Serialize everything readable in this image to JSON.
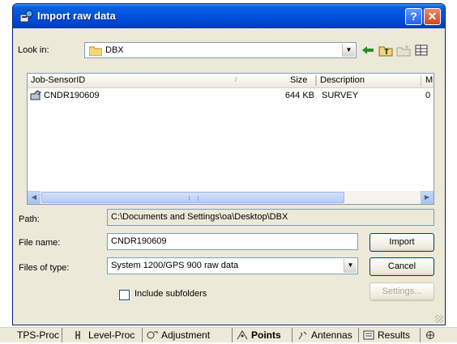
{
  "window": {
    "title": "Import raw data",
    "help_label": "?",
    "close_label": "✕"
  },
  "look_in": {
    "label": "Look in:",
    "value": "DBX",
    "icons": [
      "back-arrow-icon",
      "up-folder-icon",
      "new-folder-icon",
      "view-menu-icon"
    ]
  },
  "file_list": {
    "columns": [
      "Job-SensorID",
      "Size",
      "Description",
      "M"
    ],
    "rows": [
      {
        "name": "CNDR190609",
        "size": "644 KB",
        "description": "SURVEY",
        "m": "0"
      }
    ]
  },
  "path": {
    "label": "Path:",
    "value": "C:\\Documents and Settings\\oa\\Desktop\\DBX"
  },
  "file_name": {
    "label": "File name:",
    "value": "CNDR190609"
  },
  "file_type": {
    "label": "Files of type:",
    "value": "System 1200/GPS 900 raw data"
  },
  "include_subfolders": {
    "label": "Include subfolders",
    "checked": false
  },
  "buttons": {
    "import": "Import",
    "cancel": "Cancel",
    "settings": "Settings..."
  },
  "taskbar": {
    "tabs": [
      {
        "label": "TPS-Proc",
        "icon": "tps-icon",
        "active": false
      },
      {
        "label": "Level-Proc",
        "icon": "level-icon",
        "active": false
      },
      {
        "label": "Adjustment",
        "icon": "adjustment-icon",
        "active": false
      },
      {
        "label": "Points",
        "icon": "points-icon",
        "active": true
      },
      {
        "label": "Antennas",
        "icon": "antenna-icon",
        "active": false
      },
      {
        "label": "Results",
        "icon": "results-icon",
        "active": false
      }
    ]
  },
  "colors": {
    "titlebar": "#0053e1",
    "dialog_bg": "#ece9d8",
    "close_button": "#d6441d"
  }
}
